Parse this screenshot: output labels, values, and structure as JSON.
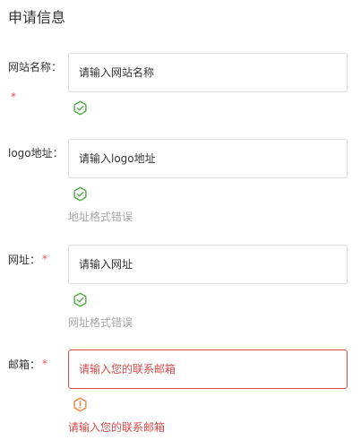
{
  "page": {
    "title": "申请信息"
  },
  "form": {
    "required_mark": "*",
    "site_name": {
      "label": "网站名称：",
      "placeholder": "请输入网站名称",
      "value": "",
      "status_icon": "check-hexagon-icon"
    },
    "logo": {
      "label": "logo地址：",
      "placeholder": "请输入logo地址",
      "value": "",
      "status_icon": "check-hexagon-icon",
      "hint": "地址格式错误"
    },
    "url": {
      "label": "网址：",
      "placeholder": "请输入网址",
      "value": "",
      "status_icon": "check-hexagon-icon",
      "hint": "网址格式错误"
    },
    "email": {
      "label": "邮箱：",
      "placeholder": "请输入您的联系邮箱",
      "value": "",
      "status_icon": "warning-hexagon-icon",
      "error": "请输入您的联系邮箱"
    }
  },
  "colors": {
    "success": "#52a845",
    "warning": "#e8833a",
    "error": "#d94a4a",
    "required": "#e25555",
    "hint": "#a6a6a6",
    "border": "#dcdcdc"
  }
}
